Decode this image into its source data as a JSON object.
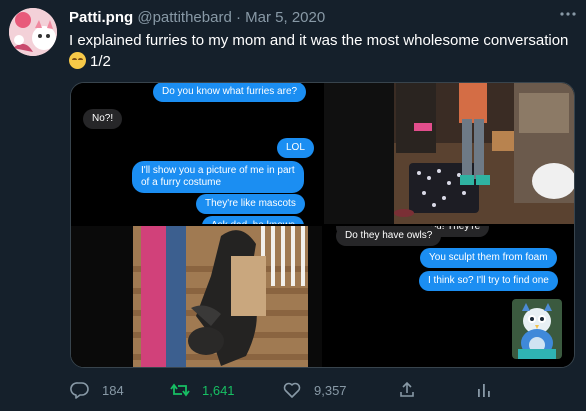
{
  "author": {
    "display_name": "Patti.png",
    "handle": "@pattithebard",
    "separator": "·",
    "date": "Mar 5, 2020"
  },
  "tweet": {
    "text": "I explained furries to my mom and it was the most wholesome conversation",
    "suffix": "1/2"
  },
  "media": {
    "panel1": {
      "messages": [
        {
          "from": "me",
          "text": "Do you know what furries are?"
        },
        {
          "from": "mom",
          "text": "No?!"
        },
        {
          "from": "me",
          "text": "LOL"
        },
        {
          "from": "me",
          "text": "I'll show you a picture of me in part"
        },
        {
          "from": "me",
          "text": "of a furry costume"
        },
        {
          "from": "me",
          "text": "They're like mascots"
        },
        {
          "from": "me",
          "text": "Ask dad, he knows"
        }
      ]
    },
    "panel4": {
      "messages": [
        {
          "from": "mom",
          "text": "Oh no!!!  Did it eat you!  They're"
        },
        {
          "from": "mom",
          "text": "Do they have owls?"
        },
        {
          "from": "me",
          "text": "You sculpt them from foam"
        },
        {
          "from": "me",
          "text": "I think so? I'll try to find one"
        }
      ]
    }
  },
  "actions": {
    "reply_count": "184",
    "retweet_count": "1,641",
    "like_count": "9,357"
  },
  "colors": {
    "background": "#15202b",
    "secondary_text": "#8899a6",
    "retweet_green": "#17bf63",
    "imessage_blue": "#1b8ef2"
  }
}
